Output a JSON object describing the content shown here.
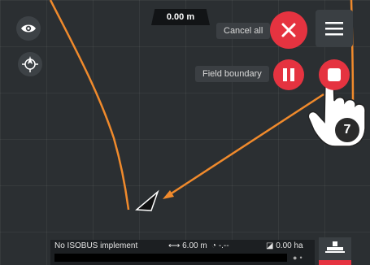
{
  "map": {
    "distance_readout": "0.00 m",
    "track_color": "#f08a2c",
    "accent_red": "#e53340"
  },
  "controls": {
    "visibility_icon": "eye-icon",
    "compass_icon": "compass-icon",
    "cancel_all_label": "Cancel all",
    "cancel_icon": "close-icon",
    "menu_icon": "hamburger-menu-icon",
    "field_boundary_label": "Field boundary",
    "pause_icon": "pause-icon",
    "record_icon": "stop-record-icon"
  },
  "tutorial": {
    "step_number": "7",
    "pointer_icon": "hand-pointer-icon"
  },
  "status_bar": {
    "implement": "No ISOBUS implement",
    "working_width": "6.00 m",
    "rate": "-.--",
    "area": "0.00 ha"
  },
  "machine_button": {
    "icon": "machine-icon"
  }
}
